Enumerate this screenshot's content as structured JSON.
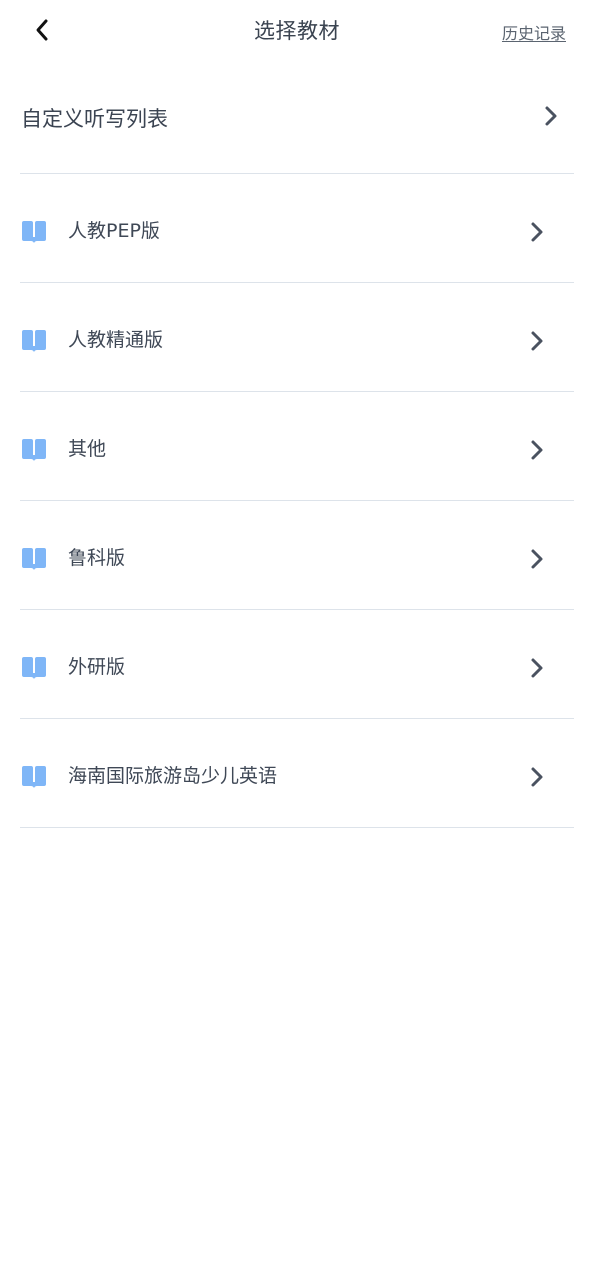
{
  "header": {
    "title": "选择教材",
    "history_label": "历史记录",
    "back_icon": "chevron-left-icon"
  },
  "custom": {
    "label": "自定义听写列表",
    "icon": "chevron-right-icon"
  },
  "textbooks": [
    {
      "label": "人教PEP版"
    },
    {
      "label": "人教精通版"
    },
    {
      "label": "其他"
    },
    {
      "label": "鲁科版"
    },
    {
      "label": "外研版"
    },
    {
      "label": "海南国际旅游岛少儿英语"
    }
  ],
  "colors": {
    "book_icon": "#7fb6f7",
    "divider": "#dde3ea",
    "chevron": "#4a5260",
    "text": "#3f4856"
  }
}
